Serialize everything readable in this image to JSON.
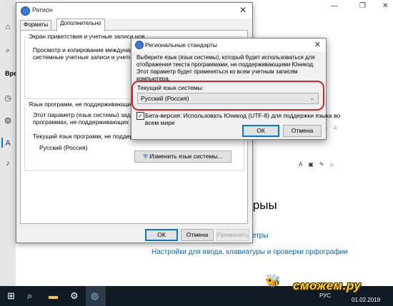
{
  "settings": {
    "heading": "трыы",
    "link1": "метры",
    "link2": "Настройки для ввода, клавиатуры и проверки орфографии",
    "sidebar_label": "Вре"
  },
  "region": {
    "title": "Регион",
    "tabs": [
      "Форматы",
      "Дополнительно"
    ],
    "welcome_group_title": "Экран приветствия и учетные записи нов",
    "welcome_text_1": "Просмотр и копирование международн",
    "welcome_text_2": "системные учетные записи и учетные зап",
    "nonunicode_group_title": "Язык программ, не поддерживающих Юнико",
    "nonunicode_text_1": "Этот параметр (язык системы) задает язы",
    "nonunicode_text_2": "программах, не поддерживающих Юникод.",
    "current_lang_label": "Текущий язык программ, не поддерживающих Юн",
    "current_lang_value": "Русский (Россия)",
    "change_lang_button": "Изменить язык системы...",
    "ok_button": "ОК",
    "cancel_button": "Отмена",
    "apply_button": "Применить"
  },
  "standards": {
    "title": "Региональные стандарты",
    "description": "Выберите язык (язык системы), который будет использоваться для отображения текста программами, не поддерживающими Юникод. Этот параметр будет применяться ко всем учетным записям компьютера.",
    "current_lang_label": "Текущий язык системы:",
    "current_lang_value": "Русский (Россия)",
    "beta_label_1": "Бета-версия: Использовать Юникод (UTF-8) для поддержки языка во",
    "beta_label_2": "всем мире",
    "beta_checked": true,
    "check_glyph": "✓",
    "ok_button": "ОК",
    "cancel_button": "Отмена",
    "highlight_color": "#e02020"
  },
  "taskbar": {
    "language": "РУС",
    "date": "01.02.2019"
  },
  "watermark": {
    "text": "сможем.ру"
  }
}
